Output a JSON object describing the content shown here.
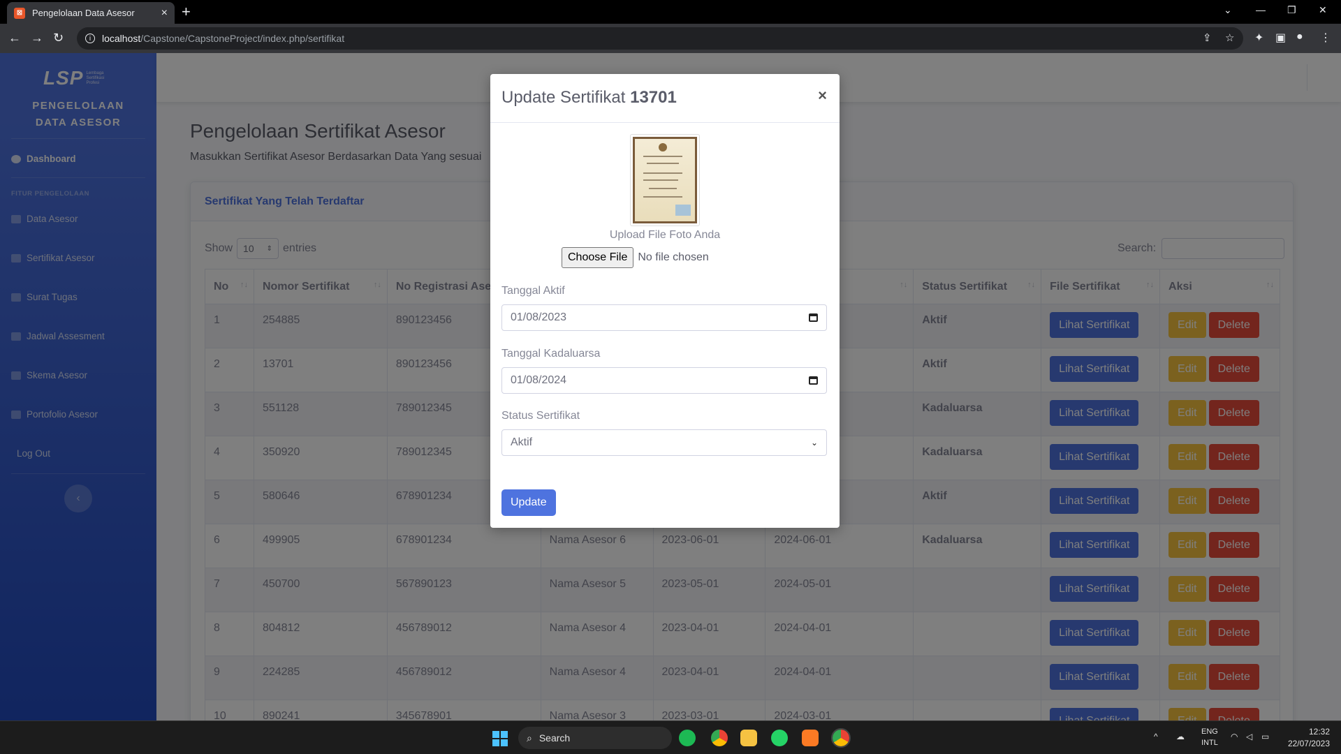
{
  "browser": {
    "tab_title": "Pengelolaan Data Asesor",
    "url_host": "localhost",
    "url_path": "/Capstone/CapstoneProject/index.php/sertifikat"
  },
  "sidebar": {
    "logo_text": "LSP",
    "logo_tagline": "Lembaga Sertifikasi Profesi",
    "brand_line1": "PENGELOLAAN",
    "brand_line2": "DATA ASESOR",
    "dashboard": "Dashboard",
    "heading": "FITUR PENGELOLAAN",
    "items": [
      {
        "label": "Data Asesor"
      },
      {
        "label": "Sertifikat Asesor"
      },
      {
        "label": "Surat Tugas"
      },
      {
        "label": "Jadwal Assesment"
      },
      {
        "label": "Skema Asesor"
      },
      {
        "label": "Portofolio Asesor"
      }
    ],
    "logout": "Log Out"
  },
  "page": {
    "title": "Pengelolaan Sertifikat Asesor",
    "subtitle": "Masukkan Sertifikat Asesor Berdasarkan Data Yang sesuai"
  },
  "card": {
    "title": "Sertifikat Yang Telah Terdaftar",
    "show_label": "Show",
    "entries_value": "10",
    "entries_label": "entries",
    "search_label": "Search:"
  },
  "table": {
    "headers": [
      "No",
      "Nomor Sertifikat",
      "No Registrasi Ase",
      "",
      "",
      "aluarsa",
      "Status Sertifikat",
      "File Sertifikat",
      "Aksi"
    ],
    "btn_view": "Lihat Sertifikat",
    "btn_edit": "Edit",
    "btn_delete": "Delete",
    "rows": [
      {
        "no": "1",
        "nomor": "254885",
        "reg": "890123456",
        "nama": "",
        "aktif": "",
        "kadaluarsa": "",
        "status": "Aktif"
      },
      {
        "no": "2",
        "nomor": "13701",
        "reg": "890123456",
        "nama": "",
        "aktif": "",
        "kadaluarsa": "",
        "status": "Aktif"
      },
      {
        "no": "3",
        "nomor": "551128",
        "reg": "789012345",
        "nama": "",
        "aktif": "",
        "kadaluarsa": "",
        "status": "Kadaluarsa"
      },
      {
        "no": "4",
        "nomor": "350920",
        "reg": "789012345",
        "nama": "",
        "aktif": "",
        "kadaluarsa": "",
        "status": "Kadaluarsa"
      },
      {
        "no": "5",
        "nomor": "580646",
        "reg": "678901234",
        "nama": "",
        "aktif": "",
        "kadaluarsa": "",
        "status": "Aktif"
      },
      {
        "no": "6",
        "nomor": "499905",
        "reg": "678901234",
        "nama": "Nama Asesor 6",
        "aktif": "2023-06-01",
        "kadaluarsa": "2024-06-01",
        "status": "Kadaluarsa"
      },
      {
        "no": "7",
        "nomor": "450700",
        "reg": "567890123",
        "nama": "Nama Asesor 5",
        "aktif": "2023-05-01",
        "kadaluarsa": "2024-05-01",
        "status": ""
      },
      {
        "no": "8",
        "nomor": "804812",
        "reg": "456789012",
        "nama": "Nama Asesor 4",
        "aktif": "2023-04-01",
        "kadaluarsa": "2024-04-01",
        "status": ""
      },
      {
        "no": "9",
        "nomor": "224285",
        "reg": "456789012",
        "nama": "Nama Asesor 4",
        "aktif": "2023-04-01",
        "kadaluarsa": "2024-04-01",
        "status": ""
      },
      {
        "no": "10",
        "nomor": "890241",
        "reg": "345678901",
        "nama": "Nama Asesor 3",
        "aktif": "2023-03-01",
        "kadaluarsa": "2024-03-01",
        "status": ""
      }
    ]
  },
  "modal": {
    "title_prefix": "Update Sertifikat",
    "title_id": "13701",
    "close": "×",
    "upload_label": "Upload File Foto Anda",
    "choose_file": "Choose File",
    "no_file": "No file chosen",
    "tanggal_aktif_label": "Tanggal Aktif",
    "tanggal_aktif_value": "01/08/2023",
    "tanggal_kadaluarsa_label": "Tanggal Kadaluarsa",
    "tanggal_kadaluarsa_value": "01/08/2024",
    "status_label": "Status Sertifikat",
    "status_value": "Aktif",
    "update_button": "Update"
  },
  "taskbar": {
    "search_placeholder": "Search",
    "lang_top": "ENG",
    "lang_bottom": "INTL",
    "time": "12:32",
    "date": "22/07/2023"
  }
}
